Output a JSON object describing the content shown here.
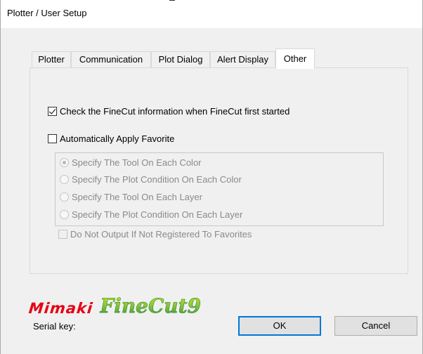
{
  "window": {
    "title": "Plotter / User Setup"
  },
  "tabs": [
    {
      "label": "Plotter",
      "active": false
    },
    {
      "label": "Communication",
      "active": false
    },
    {
      "label": "Plot Dialog",
      "active": false
    },
    {
      "label": "Alert Display",
      "active": false
    },
    {
      "label": "Other",
      "active": true
    }
  ],
  "other_tab": {
    "check_finecut_info": {
      "label": "Check the FineCut information when FineCut first started",
      "checked": true
    },
    "auto_apply_favorite": {
      "label": "Automatically Apply Favorite",
      "checked": false
    },
    "radio_options": [
      {
        "label": "Specify The Tool On Each Color",
        "selected": true,
        "enabled": false
      },
      {
        "label": "Specify The Plot Condition On Each Color",
        "selected": false,
        "enabled": false
      },
      {
        "label": "Specify The Tool On Each Layer",
        "selected": false,
        "enabled": false
      },
      {
        "label": "Specify The Plot Condition On Each Layer",
        "selected": false,
        "enabled": false
      }
    ],
    "do_not_output": {
      "label": "Do Not Output If Not Registered To Favorites",
      "checked": false,
      "enabled": false
    }
  },
  "footer": {
    "logo_brand": "Mimaki",
    "logo_product": "FineCut9",
    "serial_key_label": "Serial key:",
    "ok_label": "OK",
    "cancel_label": "Cancel"
  },
  "colors": {
    "brand_red": "#e60012",
    "product_green": "#8cc63f",
    "default_button_border": "#0078d7"
  }
}
